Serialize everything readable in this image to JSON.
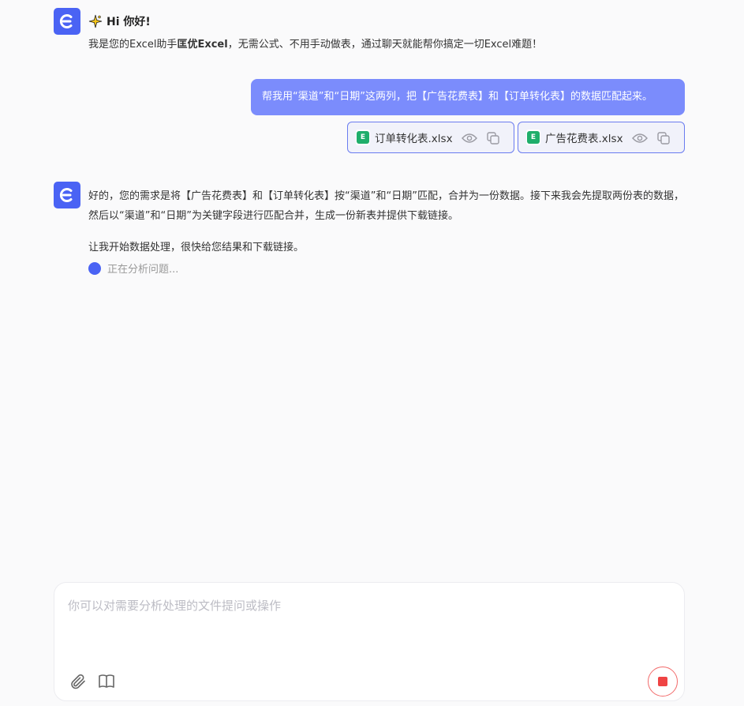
{
  "greeting": {
    "title": "Hi 你好!",
    "body_prefix": "我是您的Excel助手",
    "brand": "匡优Excel",
    "body_suffix": "，无需公式、不用手动做表，通过聊天就能帮你搞定一切Excel难题！"
  },
  "user_message": {
    "text": "帮我用“渠道”和“日期”这两列，把【广告花费表】和【订单转化表】的数据匹配起来。"
  },
  "attachments": [
    {
      "name": "订单转化表.xlsx",
      "icon": "excel-file-icon"
    },
    {
      "name": "广告花费表.xlsx",
      "icon": "excel-file-icon"
    }
  ],
  "reply": {
    "paragraph_1": "好的，您的需求是将【广告花费表】和【订单转化表】按“渠道”和“日期”匹配，合并为一份数据。接下来我会先提取两份表的数据，然后以“渠道”和“日期”为关键字段进行匹配合并，生成一份新表并提供下载链接。",
    "paragraph_2": "让我开始数据处理，很快给您结果和下载链接。",
    "status": "正在分析问题..."
  },
  "composer": {
    "placeholder": "你可以对需要分析处理的文件提问或操作",
    "value": ""
  },
  "colors": {
    "accent": "#4a63f4",
    "bubble": "#7b8cfc",
    "stop": "#ef4444",
    "excel": "#1fae6b"
  }
}
